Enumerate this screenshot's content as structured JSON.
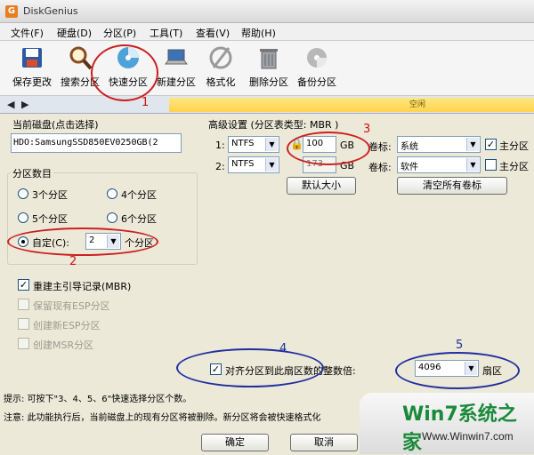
{
  "window": {
    "title": "DiskGenius",
    "icon_letter": "G"
  },
  "menu": [
    "文件(F)",
    "硬盘(D)",
    "分区(P)",
    "工具(T)",
    "查看(V)",
    "帮助(H)"
  ],
  "toolbar": {
    "save": "保存更改",
    "search": "搜索分区",
    "quick": "快速分区",
    "new": "新建分区",
    "format": "格式化",
    "delete": "删除分区",
    "backup": "备份分区"
  },
  "nav": {
    "back": "◀",
    "forward": "▶"
  },
  "banner_text": "空闲",
  "current_disk": {
    "label": "当前磁盘(点击选择)",
    "value": "HDO:SamsungSSD850EV0250GB(2"
  },
  "partition_count": {
    "title": "分区数目",
    "options": [
      "3个分区",
      "4个分区",
      "5个分区",
      "6个分区"
    ],
    "custom_label": "自定(C):",
    "custom_value": "2",
    "custom_suffix": "个分区"
  },
  "options": {
    "rebuild_mbr": "重建主引导记录(MBR)",
    "keep_esp": "保留现有ESP分区",
    "create_esp": "创建新ESP分区",
    "create_msr": "创建MSR分区"
  },
  "advanced": {
    "title": "高级设置 (分区表类型: MBR )",
    "rows": [
      {
        "index": "1:",
        "fs": "NTFS",
        "size": "100",
        "unit": "GB",
        "vol_label": "卷标:",
        "vol": "系统",
        "primary": "主分区",
        "primary_checked": true
      },
      {
        "index": "2:",
        "fs": "NTFS",
        "size": "173",
        "unit": "GB",
        "vol_label": "卷标:",
        "vol": "软件",
        "primary": "主分区",
        "primary_checked": false
      }
    ],
    "default_size": "默认大小",
    "clear_labels": "清空所有卷标"
  },
  "align": {
    "label": "对齐分区到此扇区数的整数倍:",
    "value": "4096",
    "unit": "扇区"
  },
  "hints": {
    "tip": "提示: 可按下\"3、4、5、6\"快速选择分区个数。",
    "note": "注意: 此功能执行后，当前磁盘上的现有分区将被删除。新分区将会被快速格式化"
  },
  "buttons": {
    "ok": "确定",
    "cancel": "取消"
  },
  "annotations": [
    "1",
    "2",
    "3",
    "4",
    "5"
  ],
  "watermark": {
    "brand": "Win7系统之家",
    "url": "Www.Winwin7.com"
  },
  "colors": {
    "red_ring": "#cc2020",
    "blue_ring": "#1f2f9f",
    "accent_banner": "#ffd34d"
  }
}
